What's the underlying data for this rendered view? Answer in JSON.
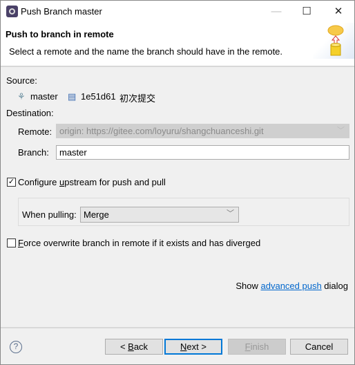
{
  "window": {
    "title": "Push Branch master",
    "minimize_icon": "minimize-icon",
    "maximize_icon": "maximize-icon",
    "close_icon": "close-icon"
  },
  "header": {
    "title": "Push to branch in remote",
    "description": "Select a remote and the name the branch should have in the remote.",
    "icon": "push-to-cloud-icon"
  },
  "source": {
    "label": "Source:",
    "branch": "master",
    "commit_id": "1e51d61",
    "commit_message": "初次提交"
  },
  "destination": {
    "label": "Destination:",
    "remote_label": "Remote:",
    "remote_value": "origin: https://gitee.com/loyuru/shangchuanceshi.git",
    "branch_label": "Branch:",
    "branch_value": "master"
  },
  "upstream": {
    "checked": true,
    "pre": "Configure ",
    "mn": "u",
    "post": "pstream for push and pull",
    "when_pulling_label": "When pulling:",
    "when_pulling_value": "Merge"
  },
  "force": {
    "checked": false,
    "pre": "",
    "mn": "F",
    "post": "orce overwrite branch in remote if it exists and has diverged"
  },
  "advanced": {
    "pre": "Show ",
    "link": "advanced push",
    "post": " dialog"
  },
  "buttons": {
    "back": {
      "pre": "< ",
      "mn": "B",
      "post": "ack"
    },
    "next": {
      "pre": "",
      "mn": "N",
      "post": "ext >"
    },
    "finish": {
      "pre": "",
      "mn": "F",
      "post": "inish",
      "disabled": true
    },
    "cancel": {
      "label": "Cancel"
    }
  },
  "colors": {
    "link": "#0066cc",
    "default_button_border": "#0078d7"
  }
}
